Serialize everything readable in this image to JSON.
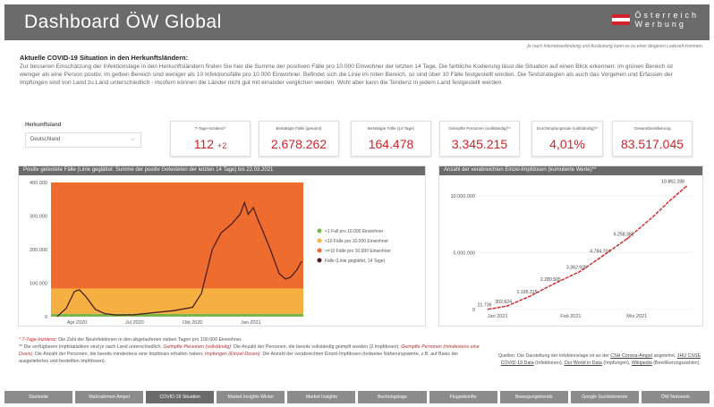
{
  "header": {
    "title": "Dashboard ÖW Global",
    "brand_line1": "Österreich",
    "brand_line2": "Werbung",
    "flag_colors": [
      "#d2232a",
      "#ffffff",
      "#d2232a"
    ]
  },
  "load_note": "Je nach Internetverbindung und Auslastung kann es zu einer längeren Ladezeit kommen.",
  "intro": {
    "heading": "Aktuelle COVID-19 Situation in den Herkunftsländern:",
    "text": "Zur besseren Einschätzung der Infektionslage in den Herkunftsländern finden Sie hier die Summe der positiven Fälle pro 10.000 Einwohner der letzten 14 Tage. Die farbliche Kodierung lässt die Situation auf einen Blick erkennen: im grünen Bereich ist weniger als eine Person positiv, im gelben Bereich sind weniger als 10 Infektionsfälle pro 10.000 Einwohner. Befindet sich die Linie im roten Bereich, so sind über 10 Fälle festgestellt worden. Die Teststrategien als auch das Vorgehen und Erfassen der Impfungen sind von Land zu Land unterschiedlich - insofern können die Länder nicht gut mit einander verglichen werden. Wohl aber kann die Tendenz in jedem Land festgestellt werden."
  },
  "country": {
    "label": "Herkunftsland",
    "selected": "Deutschland"
  },
  "kpis": {
    "incidence": {
      "label": "7-Tage-Inzidenz*",
      "value": "112",
      "delta": "+2"
    },
    "confirmed": {
      "label": "Bestätigte Fälle (gesamt)",
      "value": "2.678.262"
    },
    "confirmed14": {
      "label": "Bestätigte Fälle (14 Tage)",
      "value": "164.478"
    },
    "vaccinated": {
      "label": "Geimpfte Personen (vollständig)**",
      "value": "3.345.215"
    },
    "rate": {
      "label": "Durchimpfungsrate (vollständig)**",
      "value": "4,01%"
    },
    "population": {
      "label": "Gesamtbevölkerung",
      "value": "83.517.045"
    }
  },
  "left_panel": {
    "title": "Positiv getestete Fälle (Linie geglättet: Summe der positiv Getesteten der letzten 14 Tage) bis 22.03.2021"
  },
  "right_panel": {
    "title": "Anzahl der verabreichten Einzel-Impfdosen (kumulierte Werte)**"
  },
  "chart_data": [
    {
      "type": "area",
      "title": "Positiv getestete Fälle (Linie geglättet: Summe der positiv Getesteten der letzten 14 Tage) bis 22.03.2021",
      "y_ticks": [
        "0",
        "100.000",
        "200.000",
        "300.000",
        "400.000"
      ],
      "ylim": [
        0,
        400000
      ],
      "x_ticks": [
        "Apr 2020",
        "Jul 2020",
        "Okt 2020",
        "Jan 2021"
      ],
      "bands": [
        {
          "name": "<1 Fall pro 10.000 Einwohner",
          "color": "#7ab648",
          "from": 0,
          "to": 8400
        },
        {
          "name": "<10 Fälle pro 10.000 Einwohner",
          "color": "#f5b041",
          "from": 8400,
          "to": 84000
        },
        {
          "name": ">=10 Fälle pro 10.000 Einwohner",
          "color": "#ee6c2e",
          "from": 84000,
          "to": 400000
        }
      ],
      "series": [
        {
          "name": "Fälle (Linie geglättet, 14 Tage)",
          "color": "#4a1f1f",
          "x": [
            "2020-03-01",
            "2020-03-15",
            "2020-03-28",
            "2020-04-05",
            "2020-04-15",
            "2020-04-30",
            "2020-05-15",
            "2020-06-01",
            "2020-07-01",
            "2020-08-01",
            "2020-09-01",
            "2020-10-01",
            "2020-10-15",
            "2020-11-01",
            "2020-11-15",
            "2020-12-01",
            "2020-12-15",
            "2020-12-22",
            "2020-12-28",
            "2021-01-05",
            "2021-01-12",
            "2021-01-20",
            "2021-02-01",
            "2021-02-15",
            "2021-02-25",
            "2021-03-05",
            "2021-03-15",
            "2021-03-22"
          ],
          "y": [
            500,
            25000,
            75000,
            80000,
            60000,
            22000,
            9000,
            5000,
            6000,
            12000,
            18000,
            28000,
            70000,
            200000,
            250000,
            275000,
            305000,
            340000,
            305000,
            325000,
            290000,
            255000,
            200000,
            128000,
            112000,
            118000,
            140000,
            164478
          ]
        }
      ]
    },
    {
      "type": "line",
      "title": "Anzahl der verabreichten Einzel-Impfdosen (kumulierte Werte)**",
      "y_ticks": [
        "0",
        "5.000.000",
        "10.000.000"
      ],
      "ylim": [
        0,
        11200000
      ],
      "x_ticks": [
        "Jan 2021",
        "Feb 2021",
        "Mrz 2021"
      ],
      "series": [
        {
          "name": "Impfdosen",
          "color": "#d2232a",
          "x": [
            "2020-12-28",
            "2021-01-05",
            "2021-01-15",
            "2021-01-25",
            "2021-02-05",
            "2021-02-15",
            "2021-02-25",
            "2021-03-08",
            "2021-03-15",
            "2021-03-22"
          ],
          "y": [
            21736,
            302624,
            1195315,
            2280505,
            3362925,
            4784704,
            6258382,
            8200000,
            9600000,
            10862288
          ],
          "labels": [
            "21.736",
            "302.624",
            "1.195.315",
            "2.280.505",
            "3.362.925",
            "4.784.704",
            "6.258.382",
            "",
            "",
            "10.862.288"
          ]
        }
      ]
    }
  ],
  "footnotes": {
    "f1_term": "* 7-Tage-Inzidenz:",
    "f1_text": " Die Zahl der Neuinfektionen in den abgelaufenen sieben Tagen pro 100.000 Einwohner.",
    "f2_a": "** Die verfügbaren Impfstatistiken sind je nach Land unterschiedlich. ",
    "f2_term1": "Geimpfte Personen (vollständig):",
    "f2_b": " Die Anzahl der Personen, die bereits vollständig geimpft wurden (2 Impfdosen); ",
    "f2_term2": "Geimpfte Personen (mindestens eine Dosis):",
    "f2_c": " Die Anzahl der Personen, die bereits mindestens eine Impfdosis erhalten haben; ",
    "f2_term3": "Impfungen (Einzel-Dosen):",
    "f2_d": " Die Anzahl der verabreichten Einzel-Impfdosen (teilweise Näherungswerte, z.B. auf Basis der ausgelieferten und bestellten Impfdosen)."
  },
  "sources": {
    "prefix": "Quellen: Die Darstellung der Infektionslage ist an der ",
    "link1": "CSH Corona-Ampel",
    "mid1": " angelehnt, ",
    "link2": "JHU CSSE COVID-19 Data",
    "mid2": " (Infektionen), ",
    "link3": "Our World in Data",
    "mid3": " (Impfungen), ",
    "link4": "Wikipedia",
    "suffix": " (Bevölkerungszahlen)."
  },
  "nav": [
    "Startseite",
    "Maßnahmen-Ampel",
    "COVID-19 Situation",
    "Market Insights Winter",
    "Market Insights",
    "Buchungslage",
    "Flugankünfte",
    "Bewegungstrends",
    "Google Suchinteresse",
    "ÖW Netzwerk"
  ],
  "nav_active": 2
}
